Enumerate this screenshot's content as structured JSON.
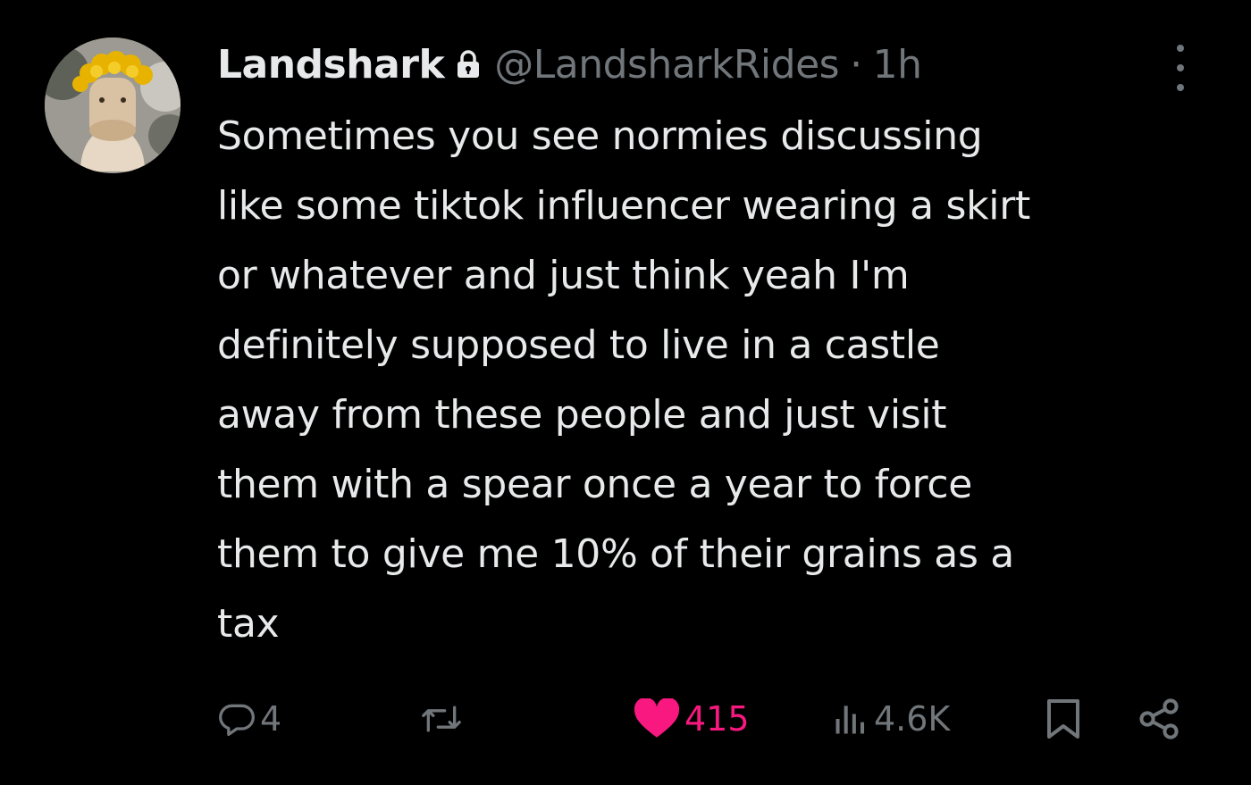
{
  "tweet": {
    "display_name": "Landshark",
    "handle": "@LandsharkRides",
    "separator": "·",
    "time": "1h",
    "lines": [
      "Sometimes you see normies discussing",
      "like some tiktok influencer wearing a skirt",
      "or whatever and just think yeah I'm",
      "definitely supposed to live in a castle",
      "away from these people and just visit",
      "them with a spear once a year to force",
      "them to give me 10% of their grains as a",
      "tax"
    ]
  },
  "actions": {
    "reply_count": "4",
    "retweet_count": "",
    "like_count": "415",
    "views_count": "4.6K"
  },
  "icons": {
    "lock": "lock-icon",
    "more": "more-icon",
    "reply": "reply-icon",
    "retweet": "retweet-icon",
    "like": "heart-icon",
    "views": "views-icon",
    "bookmark": "bookmark-icon",
    "share": "share-icon"
  },
  "colors": {
    "background": "#000000",
    "text": "#e7e9ea",
    "secondary": "#71767b",
    "like": "#f91880"
  }
}
